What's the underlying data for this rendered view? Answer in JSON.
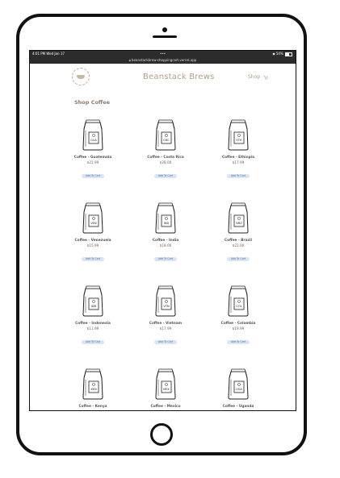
{
  "status_bar": {
    "time": "4:01 PM  Wed Jan 17",
    "dots": "•••",
    "battery": "54%",
    "battery_level": 0.54
  },
  "browser": {
    "url": "beanstackbrew-shoppingcart.vercel.app"
  },
  "header": {
    "brand": "Beanstack Brews",
    "shop_label": "Shop"
  },
  "section_title": "Shop Coffee",
  "products": [
    {
      "name": "Coffee - Guatemala",
      "price": "$21.99",
      "bag_code": "GUA",
      "button": "Add To Cart"
    },
    {
      "name": "Coffee - Costa Rica",
      "price": "$28.00",
      "bag_code": "CRC",
      "button": "Add To Cart"
    },
    {
      "name": "Coffee - Ethiopia",
      "price": "$17.99",
      "bag_code": "ETH",
      "button": "Add To Cart"
    },
    {
      "name": "Coffee - Venezuela",
      "price": "$15.99",
      "bag_code": "VEN",
      "button": "Add To Cart"
    },
    {
      "name": "Coffee - India",
      "price": "$18.00",
      "bag_code": "IND",
      "button": "Add To Cart"
    },
    {
      "name": "Coffee - Brazil",
      "price": "$22.00",
      "bag_code": "BRZ",
      "button": "Add To Cart"
    },
    {
      "name": "Coffee - Indonesia",
      "price": "$11.99",
      "bag_code": "IDN",
      "button": "Add To Cart"
    },
    {
      "name": "Coffee - Vietnam",
      "price": "$17.99",
      "bag_code": "VTN",
      "button": "Add To Cart"
    },
    {
      "name": "Coffee - Colombia",
      "price": "$19.99",
      "bag_code": "COL",
      "button": "Add To Cart"
    },
    {
      "name": "Coffee - Kenya",
      "price": "",
      "bag_code": "KEN",
      "button": ""
    },
    {
      "name": "Coffee - Mexico",
      "price": "",
      "bag_code": "MEX",
      "button": ""
    },
    {
      "name": "Coffee - Uganda",
      "price": "",
      "bag_code": "UGA",
      "button": ""
    }
  ],
  "colors": {
    "brand": "#b39f86",
    "button_bg": "#d9e5f6",
    "button_text": "#4a6fa5",
    "status_bar": "#2c2c2c"
  }
}
